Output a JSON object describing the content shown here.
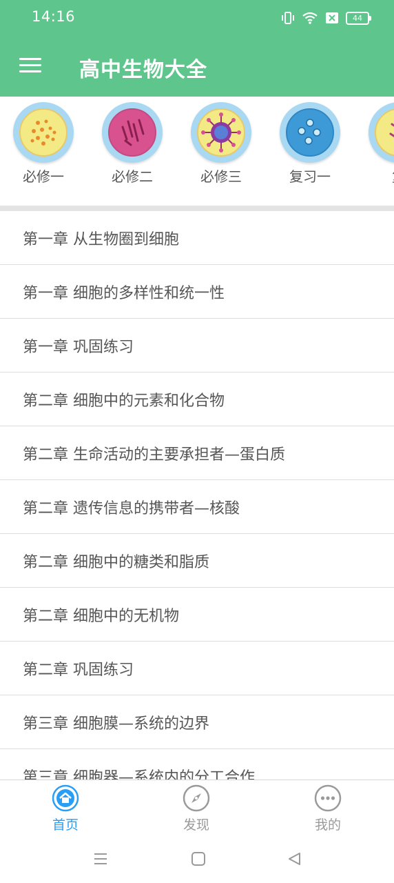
{
  "status": {
    "time": "14:16",
    "battery": "44",
    "icons": [
      "vibrate-icon",
      "wifi-icon",
      "sim-off-icon",
      "battery-icon"
    ]
  },
  "app": {
    "title": "高中生物大全",
    "menu_icon": "hamburger-menu-icon",
    "accent_color": "#5ec68c"
  },
  "categories": [
    {
      "label": "必修一",
      "icon": "yellow-cell-icon"
    },
    {
      "label": "必修二",
      "icon": "pink-cell-icon"
    },
    {
      "label": "必修三",
      "icon": "virus-cell-icon"
    },
    {
      "label": "复习一",
      "icon": "blue-cell-icon"
    },
    {
      "label": "复",
      "icon": "partial-cell-icon"
    }
  ],
  "chapters": [
    "第一章 从生物圈到细胞",
    "第一章 细胞的多样性和统一性",
    "第一章 巩固练习",
    "第二章 细胞中的元素和化合物",
    "第二章 生命活动的主要承担者—蛋白质",
    "第二章 遗传信息的携带者—核酸",
    "第二章 细胞中的糖类和脂质",
    "第二章 细胞中的无机物",
    "第二章 巩固练习",
    "第三章 细胞膜—系统的边界",
    "第三章 细胞器—系统内的分工合作"
  ],
  "bottom_nav": [
    {
      "label": "首页",
      "icon": "home-icon",
      "active": true
    },
    {
      "label": "发现",
      "icon": "compass-icon",
      "active": false
    },
    {
      "label": "我的",
      "icon": "more-dots-icon",
      "active": false
    }
  ],
  "colors": {
    "nav_active": "#2a9df4",
    "nav_inactive": "#9a9a9a",
    "text": "#555555"
  }
}
